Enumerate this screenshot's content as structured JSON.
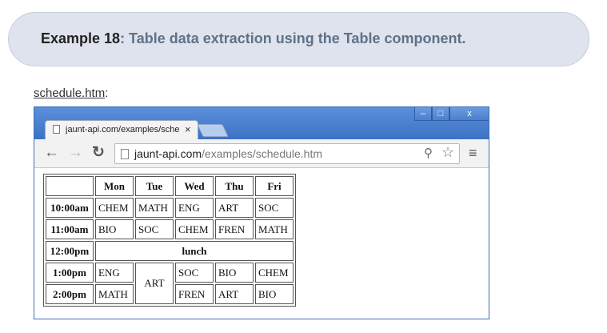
{
  "header": {
    "label": "Example 18",
    "title": ": Table data extraction using the Table component."
  },
  "file_link": {
    "text": "schedule.htm",
    "suffix": ":"
  },
  "browser": {
    "tab_title": "jaunt-api.com/examples/schedule.htm",
    "tab_close": "×",
    "window_buttons": {
      "minimize": "–",
      "maximize": "□",
      "close": "x"
    },
    "url_domain": "jaunt-api.com",
    "url_path": "/examples/schedule.htm"
  },
  "schedule": {
    "columns": [
      "Mon",
      "Tue",
      "Wed",
      "Thu",
      "Fri"
    ],
    "rows": [
      {
        "time": "10:00am",
        "cells": [
          "CHEM",
          "MATH",
          "ENG",
          "ART",
          "SOC"
        ]
      },
      {
        "time": "11:00am",
        "cells": [
          "BIO",
          "SOC",
          "CHEM",
          "FREN",
          "MATH"
        ]
      },
      {
        "time": "12:00pm",
        "lunch": "lunch"
      },
      {
        "time": "1:00pm",
        "mon": "ENG",
        "tue_merged": "ART",
        "wed": "SOC",
        "thu": "BIO",
        "fri": "CHEM"
      },
      {
        "time": "2:00pm",
        "mon": "MATH",
        "wed": "FREN",
        "thu": "ART",
        "fri": "BIO"
      }
    ]
  },
  "icons": {
    "back": "arrow-left-icon",
    "forward": "arrow-right-icon",
    "reload": "reload-icon",
    "page": "page-icon",
    "zoom": "zoom-icon",
    "star": "star-icon",
    "menu": "menu-icon"
  },
  "colors": {
    "header_bg": "#dfe3ee",
    "header_title": "#5e7286",
    "browser_frame": "#3d72c4"
  }
}
